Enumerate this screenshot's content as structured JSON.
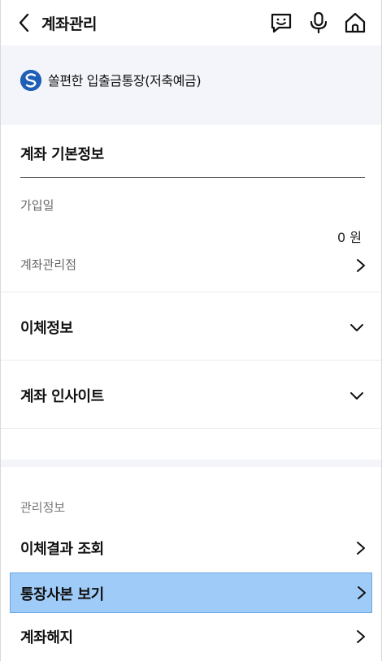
{
  "header": {
    "title": "계좌관리",
    "icons": [
      "back-icon",
      "chatbot-icon",
      "microphone-icon",
      "home-icon"
    ]
  },
  "account": {
    "name": "쏠편한 입출금통장(저축예금)",
    "logo": "shinhan-logo"
  },
  "basic_info": {
    "title": "계좌 기본정보",
    "join_date_label": "가입일",
    "balance": "0 원",
    "branch_label": "계좌관리점"
  },
  "accordions": {
    "transfer_info": "이체정보",
    "insight": "계좌 인사이트"
  },
  "management": {
    "label": "관리정보",
    "items": [
      {
        "label": "이체결과 조회"
      },
      {
        "label": "통장사본 보기"
      },
      {
        "label": "계좌해지"
      }
    ]
  },
  "colors": {
    "banner_bg": "#f3f5fa",
    "highlight": "#9ecbf7",
    "logo_blue": "#1f5fb8"
  }
}
